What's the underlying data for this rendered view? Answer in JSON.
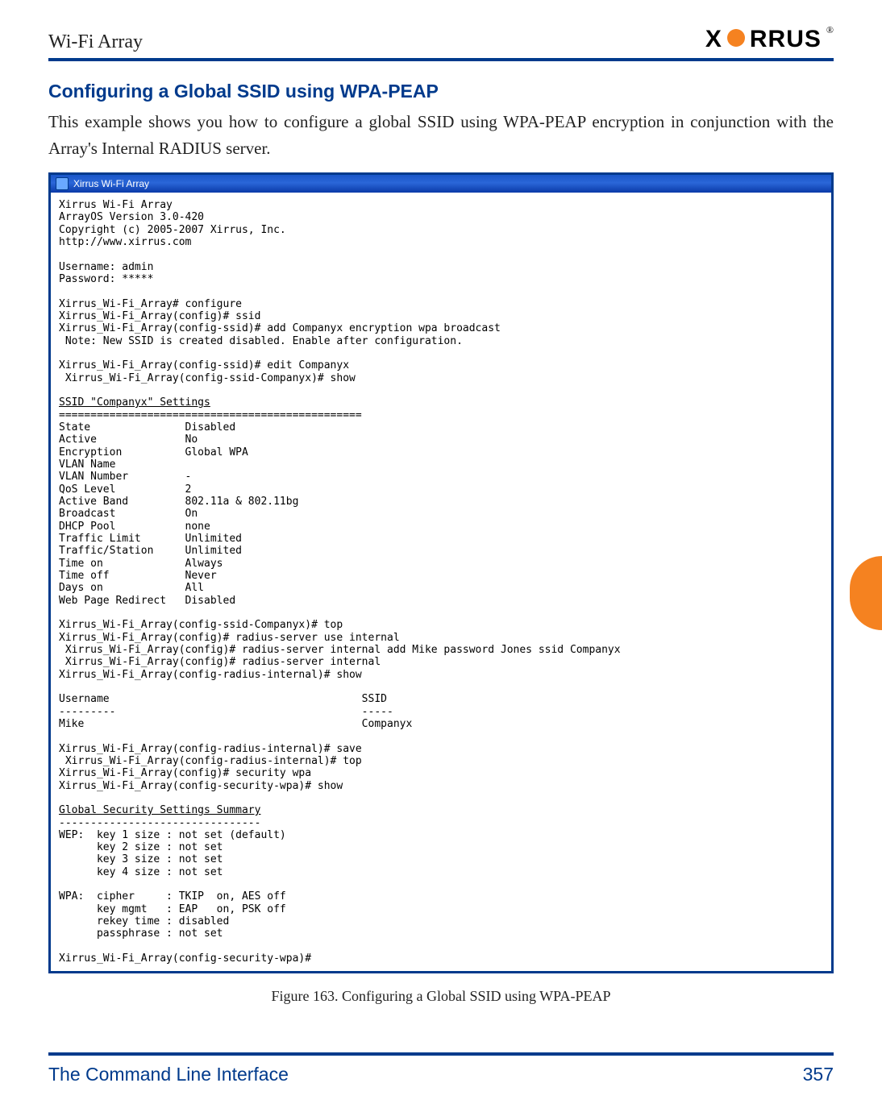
{
  "header": {
    "running_head": "Wi-Fi Array",
    "logo_text_left": "X",
    "logo_text_right": "RRUS"
  },
  "section": {
    "heading": "Configuring a Global SSID using WPA-PEAP",
    "body": "This example shows you how to configure a global SSID using WPA-PEAP encryption in conjunction with the Array's Internal RADIUS server."
  },
  "terminal": {
    "title": "Xirrus Wi-Fi Array",
    "lines": [
      "Xirrus Wi-Fi Array",
      "ArrayOS Version 3.0-420",
      "Copyright (c) 2005-2007 Xirrus, Inc.",
      "http://www.xirrus.com",
      "",
      "Username: admin",
      "Password: *****",
      "",
      "Xirrus_Wi-Fi_Array# configure",
      "Xirrus_Wi-Fi_Array(config)# ssid",
      "Xirrus_Wi-Fi_Array(config-ssid)# add Companyx encryption wpa broadcast",
      " Note: New SSID is created disabled. Enable after configuration.",
      "",
      "Xirrus_Wi-Fi_Array(config-ssid)# edit Companyx",
      " Xirrus_Wi-Fi_Array(config-ssid-Companyx)# show",
      ""
    ],
    "settings_header": "SSID \"Companyx\" Settings",
    "settings_divider": "================================================",
    "settings": [
      [
        "State",
        "Disabled"
      ],
      [
        "Active",
        "No"
      ],
      [
        "Encryption",
        "Global WPA"
      ],
      [
        "VLAN Name",
        ""
      ],
      [
        "VLAN Number",
        "-"
      ],
      [
        "QoS Level",
        "2"
      ],
      [
        "Active Band",
        "802.11a & 802.11bg"
      ],
      [
        "Broadcast",
        "On"
      ],
      [
        "DHCP Pool",
        "none"
      ],
      [
        "Traffic Limit",
        "Unlimited"
      ],
      [
        "Traffic/Station",
        "Unlimited"
      ],
      [
        "Time on",
        "Always"
      ],
      [
        "Time off",
        "Never"
      ],
      [
        "Days on",
        "All"
      ],
      [
        "Web Page Redirect",
        "Disabled"
      ]
    ],
    "after_settings": [
      "",
      "Xirrus_Wi-Fi_Array(config-ssid-Companyx)# top",
      "Xirrus_Wi-Fi_Array(config)# radius-server use internal",
      " Xirrus_Wi-Fi_Array(config)# radius-server internal add Mike password Jones ssid Companyx",
      " Xirrus_Wi-Fi_Array(config)# radius-server internal",
      "Xirrus_Wi-Fi_Array(config-radius-internal)# show",
      ""
    ],
    "user_table_header": [
      "Username",
      "SSID"
    ],
    "user_table_divider": [
      "---------",
      "-----"
    ],
    "user_table_row": [
      "Mike",
      "Companyx"
    ],
    "after_users": [
      "",
      "Xirrus_Wi-Fi_Array(config-radius-internal)# save",
      " Xirrus_Wi-Fi_Array(config-radius-internal)# top",
      "Xirrus_Wi-Fi_Array(config)# security wpa",
      "Xirrus_Wi-Fi_Array(config-security-wpa)# show",
      ""
    ],
    "security_header": "Global Security Settings Summary",
    "security_divider": "--------------------------------",
    "security_lines": [
      "WEP:  key 1 size : not set (default)",
      "      key 2 size : not set",
      "      key 3 size : not set",
      "      key 4 size : not set",
      "",
      "WPA:  cipher     : TKIP  on, AES off",
      "      key mgmt   : EAP   on, PSK off",
      "      rekey time : disabled",
      "      passphrase : not set",
      "",
      "Xirrus_Wi-Fi_Array(config-security-wpa)#"
    ]
  },
  "figure_caption": "Figure 163. Configuring a Global SSID using WPA-PEAP",
  "footer": {
    "left": "The Command Line Interface",
    "right": "357"
  }
}
